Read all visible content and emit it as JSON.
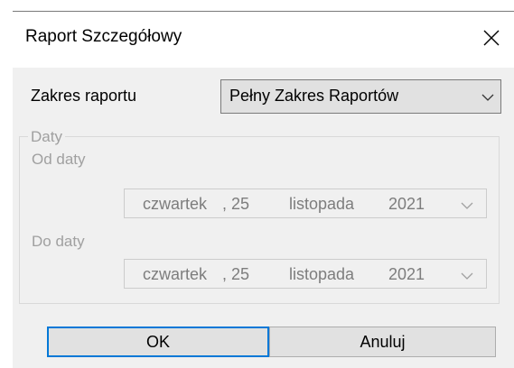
{
  "dialog": {
    "title": "Raport Szczegółowy"
  },
  "report_range": {
    "label": "Zakres raportu",
    "selected": "Pełny Zakres Raportów"
  },
  "dates_group": {
    "legend": "Daty",
    "from_label": "Od daty",
    "from_date": {
      "weekday": "czwartek",
      "sep_day": ", 25",
      "month": "listopada",
      "year": "2021"
    },
    "to_label": "Do daty",
    "to_date": {
      "weekday": "czwartek",
      "sep_day": ", 25",
      "month": "listopada",
      "year": "2021"
    }
  },
  "buttons": {
    "ok": "OK",
    "cancel": "Anuluj"
  },
  "icons": {
    "close": "close-icon",
    "dropdown": "chevron-down-icon"
  },
  "colors": {
    "focus_border": "#0078d7",
    "disabled_text": "#a0a0a0",
    "dialog_background": "#f0f0f0"
  }
}
